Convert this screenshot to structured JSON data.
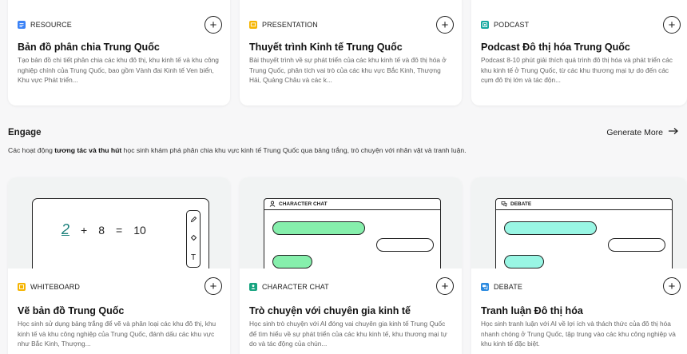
{
  "top_cards": [
    {
      "tag": "RESOURCE",
      "tag_color": "#3b82f6",
      "title": "Bản đồ phân chia Trung Quốc",
      "desc": "Tạo bản đồ chi tiết phân chia các khu đô thị, khu kinh tế và khu công nghiệp chính của Trung Quốc, bao gồm Vành đai Kinh tế Ven biển, Khu vực Phát triển..."
    },
    {
      "tag": "PRESENTATION",
      "tag_color": "#f5b400",
      "title": "Thuyết trình Kinh tế Trung Quốc",
      "desc": "Bài thuyết trình về sự phát triển của các khu kinh tế và đô thị hóa ở Trung Quốc, phân tích vai trò của các khu vực Bắc Kinh, Thượng Hải, Quảng Châu và các k..."
    },
    {
      "tag": "PODCAST",
      "tag_color": "#14a8a0",
      "title": "Podcast Đô thị hóa Trung Quốc",
      "desc": "Podcast 8-10 phút giải thích quá trình đô thị hóa và phát triển các khu kinh tế ở Trung Quốc, từ các khu thương mại tự do đến các cụm đô thị lớn và tác độn..."
    }
  ],
  "engage": {
    "title": "Engage",
    "generate_more": "Generate More",
    "desc_prefix": "Các hoạt động ",
    "desc_bold": "tương tác và thu hút",
    "desc_suffix": " học sinh khám phá phân chia khu vực kinh tế Trung Quốc qua bảng trắng, trò chuyện với nhân vật và tranh luận."
  },
  "bottom_cards": [
    {
      "tag": "WHITEBOARD",
      "tag_color": "#f5b400",
      "title": "Vẽ bản đồ Trung Quốc",
      "desc": "Học sinh sử dụng bảng trắng để vẽ và phân loại các khu đô thị, khu kinh tế và khu công nghiệp của Trung Quốc, đánh dấu các khu vực như Bắc Kinh, Thượng...",
      "preview": {
        "eq_a": "2",
        "eq_op": "+",
        "eq_b": "8",
        "eq_eq": "=",
        "eq_c": "10"
      }
    },
    {
      "tag": "CHARACTER CHAT",
      "tag_color": "#16a37f",
      "title": "Trò chuyện với chuyên gia kinh tế",
      "desc": "Học sinh trò chuyện với AI đóng vai chuyên gia kinh tế Trung Quốc để tìm hiểu về sự phát triển của các khu kinh tế, khu thương mại tự do và tác động của chún...",
      "preview_label": "CHARACTER CHAT",
      "bubble_color": "#86efac"
    },
    {
      "tag": "DEBATE",
      "tag_color": "#2b8ae0",
      "title": "Tranh luận Đô thị hóa",
      "desc": "Học sinh tranh luận với AI về lợi ích và thách thức của đô thị hóa nhanh chóng ở Trung Quốc, tập trung vào các khu công nghiệp và khu kinh tế đặc biệt.",
      "preview_label": "DEBATE",
      "bubble_color": "#99f6e4"
    }
  ]
}
